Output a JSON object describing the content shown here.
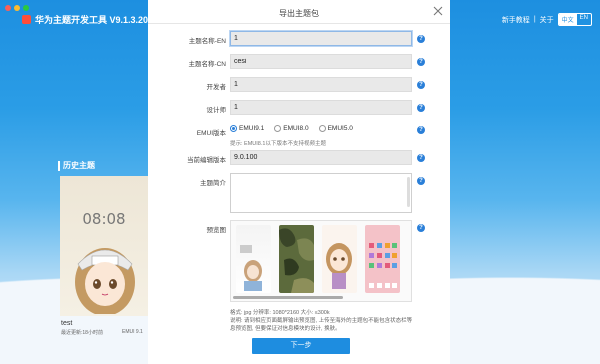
{
  "app": {
    "title": "华为主题开发工具 V9.1.3.208",
    "nav": {
      "tutorial": "新手教程",
      "about": "关于"
    },
    "lang": {
      "zh": "中文",
      "en": "EN"
    }
  },
  "history": {
    "title": "历史主题",
    "card_time": "08:08",
    "theme_name": "test",
    "theme_sub": "最近更新:18小时前",
    "theme_version": "EMUI 9.1"
  },
  "dialog": {
    "title": "导出主题包",
    "fields": {
      "name_en": {
        "label": "主题名称-EN",
        "value": "1"
      },
      "name_cn": {
        "label": "主题名称-CN",
        "value": "cesi"
      },
      "developer": {
        "label": "开发者",
        "value": "1"
      },
      "designer": {
        "label": "设计师",
        "value": "1"
      },
      "emui": {
        "label": "EMUI版本",
        "options": [
          "EMUI9.1",
          "EMUI8.0",
          "EMUI5.0"
        ],
        "selected": "EMUI9.1",
        "tip": "提示: EMUI8.1以下版本不支持视频主题"
      },
      "current_version": {
        "label": "当前编辑版本",
        "value": "9.0.100"
      },
      "intro": {
        "label": "主题简介",
        "value": ""
      },
      "preview": {
        "label": "预览图"
      }
    },
    "format_line1": "格式: jpg 分辨率: 1080*2160 大小: ≤300k",
    "format_line2": "说明: 请到相应页面截屏输出预览图, 上传至海外的主题包不能包含状态栏等",
    "format_line3": "息预览图, 但要保证对信息模块的设计, 换肤。",
    "next_button": "下一步",
    "help_glyph": "?"
  },
  "colors": {
    "accent": "#1e8de0",
    "help": "#2a7fd8"
  }
}
